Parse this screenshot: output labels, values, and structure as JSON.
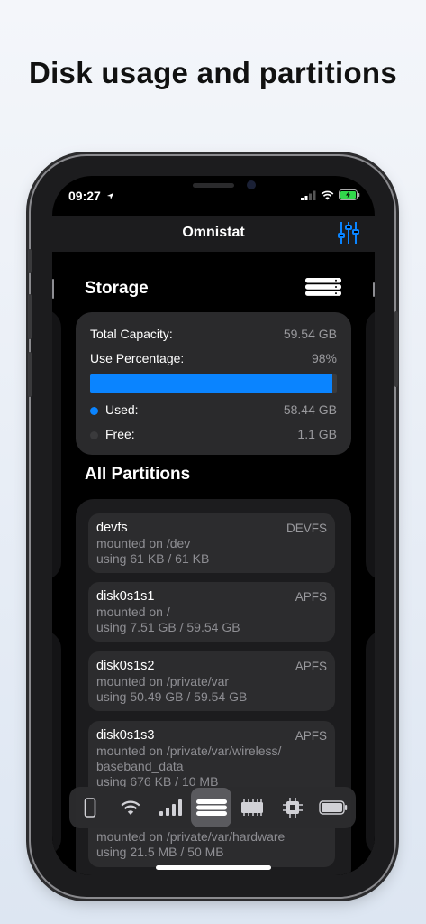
{
  "headline": "Disk usage and partitions",
  "status": {
    "time": "09:27"
  },
  "nav": {
    "title": "Omnistat"
  },
  "storage": {
    "title": "Storage",
    "total_label": "Total Capacity:",
    "total_value": "59.54 GB",
    "percent_label": "Use Percentage:",
    "percent_value": "98%",
    "used_fraction": 0.98,
    "used_label": "Used:",
    "used_value": "58.44 GB",
    "free_label": "Free:",
    "free_value": "1.1 GB",
    "colors": {
      "used": "#0a84ff",
      "free": "#3a3a3c"
    }
  },
  "partitions": {
    "title": "All Partitions",
    "items": [
      {
        "name": "devfs",
        "fs": "DEVFS",
        "mount": "mounted on /dev",
        "usage": "using 61 KB / 61 KB"
      },
      {
        "name": "disk0s1s1",
        "fs": "APFS",
        "mount": "mounted on /",
        "usage": "using 7.51 GB / 59.54 GB"
      },
      {
        "name": "disk0s1s2",
        "fs": "APFS",
        "mount": "mounted on /private/var",
        "usage": "using 50.49 GB / 59.54 GB"
      },
      {
        "name": "disk0s1s3",
        "fs": "APFS",
        "mount": "mounted on /private/var/wireless/",
        "mount2": "baseband_data",
        "usage": "using 676 KB / 10 MB"
      },
      {
        "mount": "mounted on /private/var/hardware",
        "usage": "using 21.5 MB / 50 MB"
      }
    ]
  },
  "tabs": [
    {
      "icon": "phone-icon"
    },
    {
      "icon": "wifi-icon"
    },
    {
      "icon": "cellular-icon"
    },
    {
      "icon": "storage-icon",
      "active": true
    },
    {
      "icon": "memory-icon"
    },
    {
      "icon": "cpu-icon"
    },
    {
      "icon": "battery-icon"
    }
  ],
  "accent": "#0a84ff"
}
